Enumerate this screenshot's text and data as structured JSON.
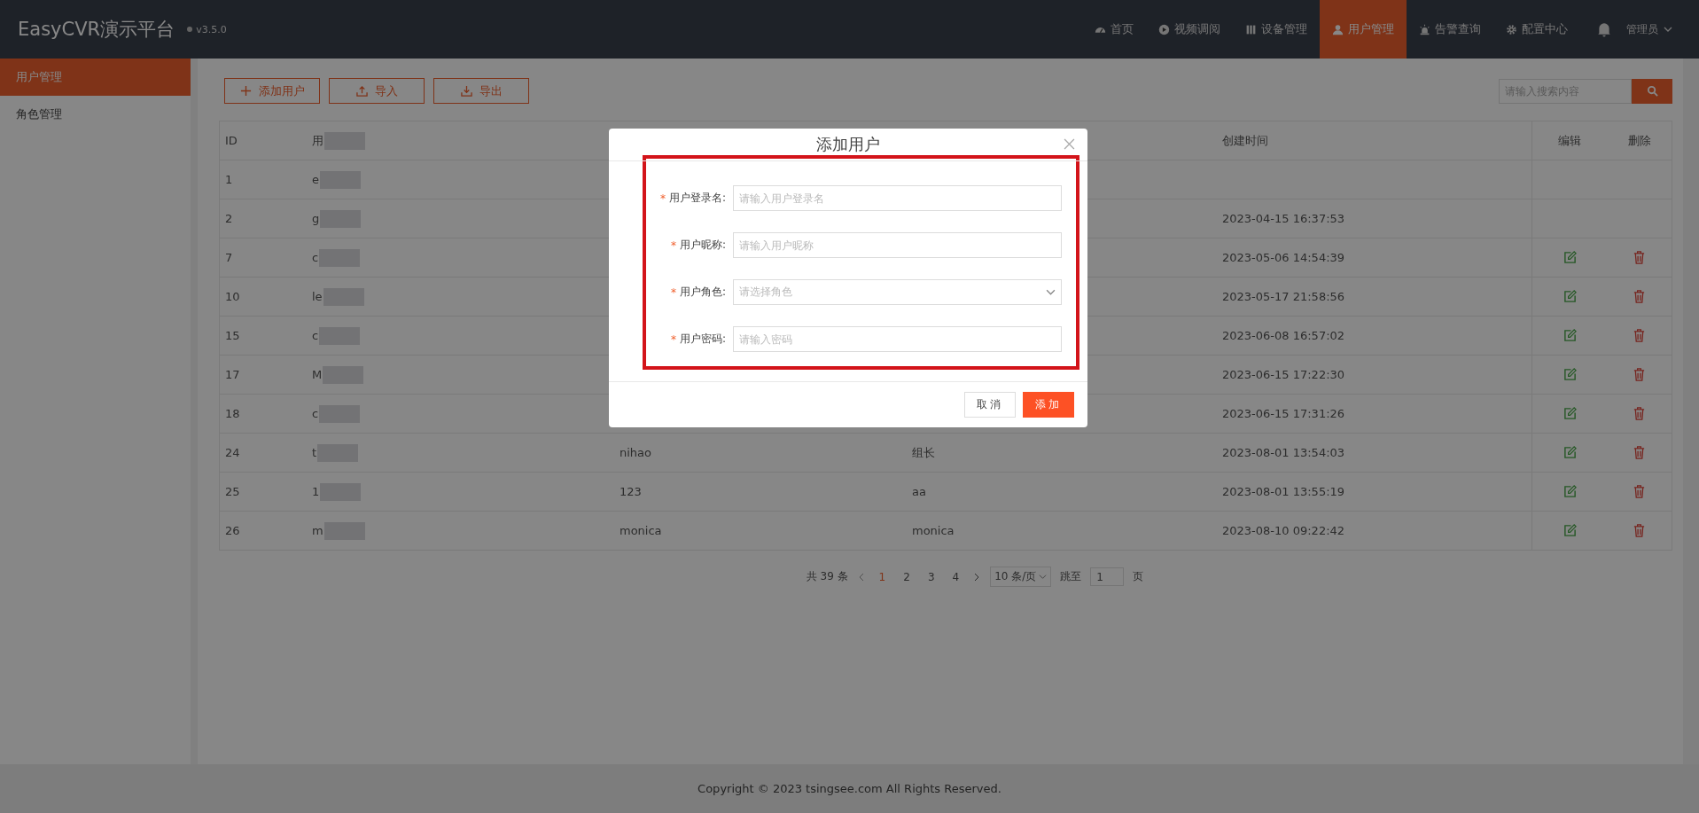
{
  "header": {
    "logo": "EasyCVR演示平台",
    "version": "v3.5.0",
    "nav": [
      {
        "label": "首页",
        "selected": false
      },
      {
        "label": "视频调阅",
        "selected": false
      },
      {
        "label": "设备管理",
        "selected": false
      },
      {
        "label": "用户管理",
        "selected": true
      },
      {
        "label": "告警查询",
        "selected": false
      },
      {
        "label": "配置中心",
        "selected": false
      }
    ],
    "user": "管理员"
  },
  "sidebar": {
    "items": [
      {
        "label": "用户管理",
        "selected": true
      },
      {
        "label": "角色管理",
        "selected": false
      }
    ]
  },
  "toolbar": {
    "buttons": [
      {
        "label": "添加用户"
      },
      {
        "label": "导入"
      },
      {
        "label": "导出"
      }
    ],
    "search": {
      "placeholder": "请输入搜索内容"
    }
  },
  "table": {
    "columns": [
      "ID",
      "用",
      "创建时间",
      "编辑",
      "删除"
    ],
    "rows": [
      {
        "id": "1",
        "name": "e",
        "editable": false
      },
      {
        "id": "2",
        "name": "g",
        "created": "2023-04-15 16:37:53",
        "editable": false
      },
      {
        "id": "7",
        "name": "c",
        "created": "2023-05-06 14:54:39",
        "editable": true
      },
      {
        "id": "10",
        "name": "le",
        "created": "2023-05-17 21:58:56",
        "editable": true
      },
      {
        "id": "15",
        "name": "c",
        "created": "2023-06-08 16:57:02",
        "editable": true
      },
      {
        "id": "17",
        "name": "M",
        "created": "2023-06-15 17:22:30",
        "editable": true
      },
      {
        "id": "18",
        "name": "c",
        "created": "2023-06-15 17:31:26",
        "editable": true
      },
      {
        "id": "24",
        "name": "t",
        "column_3": "nihao",
        "column_4": "组长",
        "created": "2023-08-01 13:54:03",
        "editable": true
      },
      {
        "id": "25",
        "name": "1",
        "column_3": "123",
        "column_4": "aa",
        "created": "2023-08-01 13:55:19",
        "editable": true
      },
      {
        "id": "26",
        "name": "m",
        "column_3": "monica",
        "column_4": "monica",
        "created": "2023-08-10 09:22:42",
        "editable": true
      }
    ]
  },
  "pagination": {
    "total": "共 39 条",
    "pages": [
      {
        "label": "1",
        "selected": true
      },
      {
        "label": "2",
        "selected": false
      },
      {
        "label": "3",
        "selected": false
      },
      {
        "label": "4",
        "selected": false
      }
    ],
    "page_size": "10 条/页",
    "goto_label": "跳至",
    "goto_value": "1",
    "goto_suffix": "页"
  },
  "footer": "Copyright © 2023 tsingsee.com All Rights Reserved.",
  "dialog": {
    "title": "添加用户",
    "highlighted": true,
    "fields": [
      {
        "label": "用户登录名:",
        "asterisk": "*",
        "placeholder": "请输入用户登录名",
        "kind": "text"
      },
      {
        "label": "用户昵称:",
        "asterisk": "*",
        "placeholder": "请输入用户昵称",
        "kind": "text"
      },
      {
        "label": "用户角色:",
        "asterisk": "*",
        "placeholder": "请选择角色",
        "kind": "select"
      },
      {
        "label": "用户密码:",
        "asterisk": "*",
        "placeholder": "请输入密码",
        "kind": "text"
      }
    ],
    "cancel": "取消",
    "confirm": "添加"
  }
}
